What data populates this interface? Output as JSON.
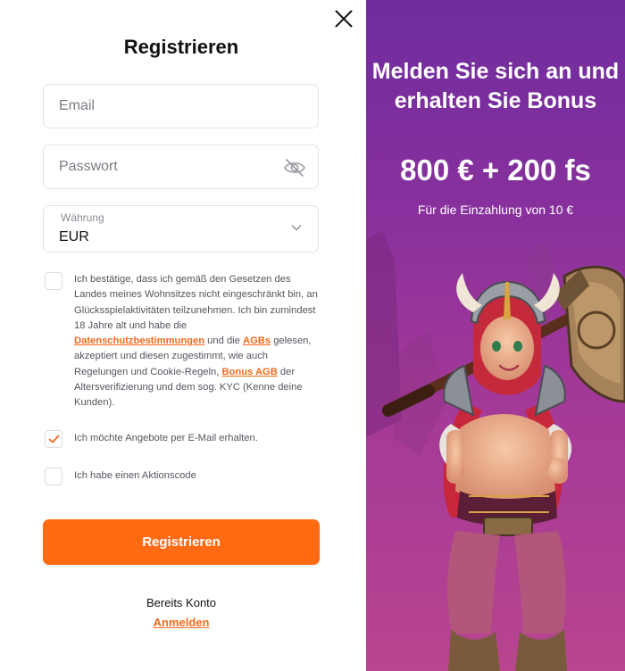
{
  "register_form": {
    "title": "Registrieren",
    "email_placeholder": "Email",
    "password_placeholder": "Passwort",
    "currency_label": "Währung",
    "currency_value": "EUR",
    "terms": {
      "part1": "Ich bestätige, dass ich gemäß den Gesetzen des Landes meines Wohnsitzes nicht eingeschränkt bin, an Glücksspielaktivitäten teilzunehmen. Ich bin zumindest 18 Jahre alt und habe die ",
      "privacy_link": "Datenschutzbestimmungen",
      "part2": " und die ",
      "agb_link": "AGBs",
      "part3": " gelesen, akzeptiert und diesen zugestimmt, wie auch Regelungen und Cookie-Regeln, ",
      "bonus_link": "Bonus AGB",
      "part4": " der Altersverifizierung und dem sog. KYC (Kenne deine Kunden).",
      "checked": false
    },
    "email_offers": {
      "label": "Ich möchte Angebote per E-Mail erhalten.",
      "checked": true
    },
    "promo_code": {
      "label": "Ich habe einen Aktionscode",
      "checked": false
    },
    "submit_label": "Registrieren",
    "has_account_text": "Bereits Konto",
    "login_link": "Anmelden"
  },
  "promo": {
    "headline": "Melden Sie sich an und erhalten Sie Bonus",
    "amount": "800 € + 200 fs",
    "subtext": "Für die Einzahlung von 10 €"
  },
  "colors": {
    "accent": "#ff6a13",
    "link": "#f26a1b",
    "promo_gradient_top": "#6f2d9e",
    "promo_gradient_bottom": "#b23f93"
  }
}
